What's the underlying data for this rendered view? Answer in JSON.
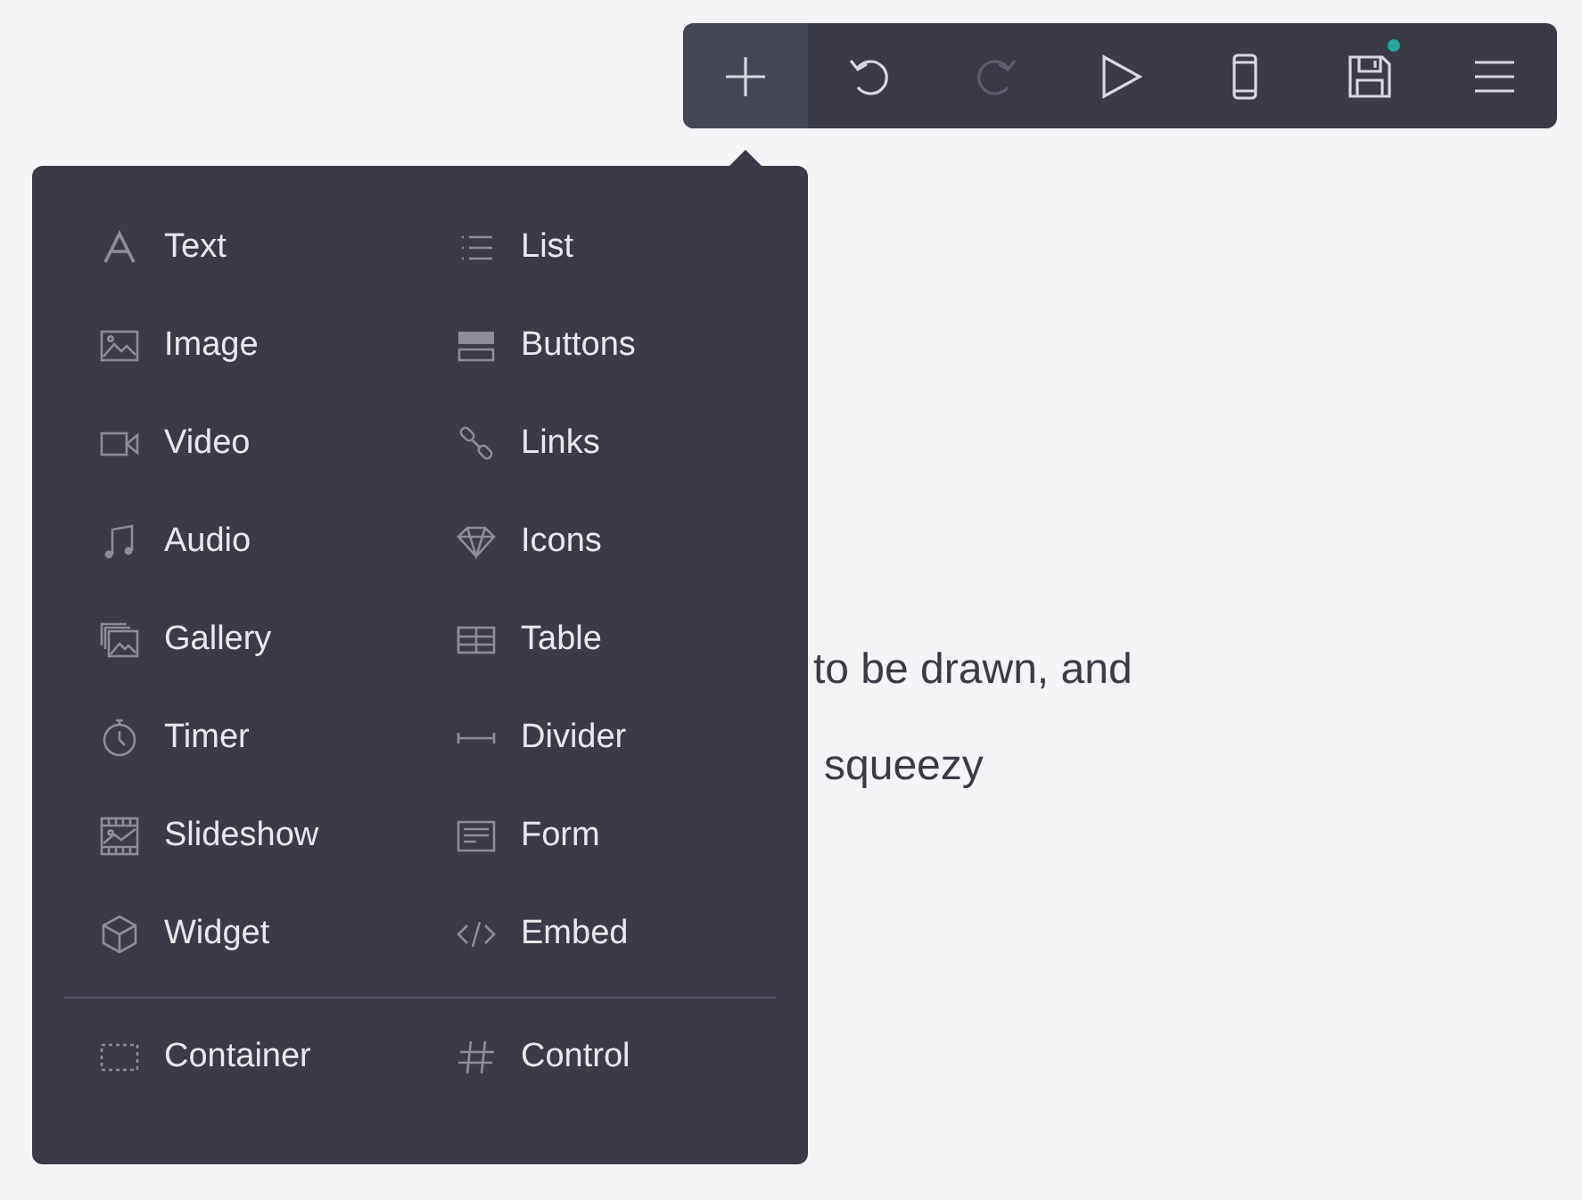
{
  "toolbar": {
    "buttons": [
      {
        "kind": "add",
        "selected": true,
        "disabled": false,
        "notification": false
      },
      {
        "kind": "undo",
        "selected": false,
        "disabled": false,
        "notification": false
      },
      {
        "kind": "redo",
        "selected": false,
        "disabled": true,
        "notification": false
      },
      {
        "kind": "play",
        "selected": false,
        "disabled": false,
        "notification": false
      },
      {
        "kind": "device",
        "selected": false,
        "disabled": false,
        "notification": false
      },
      {
        "kind": "save",
        "selected": false,
        "disabled": false,
        "notification": true
      },
      {
        "kind": "menu",
        "selected": false,
        "disabled": false,
        "notification": false
      }
    ]
  },
  "content": {
    "paragraph_lines": [
      "to be drawn, and",
      "squeezy"
    ]
  },
  "insert_menu": {
    "items": [
      {
        "kind": "text",
        "label": "Text"
      },
      {
        "kind": "list",
        "label": "List"
      },
      {
        "kind": "image",
        "label": "Image"
      },
      {
        "kind": "buttons",
        "label": "Buttons"
      },
      {
        "kind": "video",
        "label": "Video"
      },
      {
        "kind": "links",
        "label": "Links"
      },
      {
        "kind": "audio",
        "label": "Audio"
      },
      {
        "kind": "icons",
        "label": "Icons"
      },
      {
        "kind": "gallery",
        "label": "Gallery"
      },
      {
        "kind": "table",
        "label": "Table"
      },
      {
        "kind": "timer",
        "label": "Timer"
      },
      {
        "kind": "divider",
        "label": "Divider"
      },
      {
        "kind": "slideshow",
        "label": "Slideshow"
      },
      {
        "kind": "form",
        "label": "Form"
      },
      {
        "kind": "widget",
        "label": "Widget"
      },
      {
        "kind": "embed",
        "label": "Embed"
      }
    ],
    "footer_items": [
      {
        "kind": "container",
        "label": "Container"
      },
      {
        "kind": "control",
        "label": "Control"
      }
    ]
  }
}
